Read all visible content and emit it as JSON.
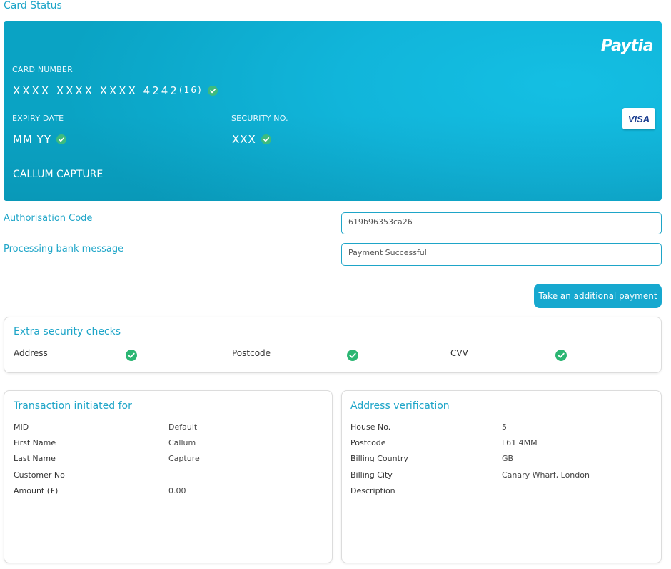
{
  "page_title": "Card Status",
  "card": {
    "brand": "Paytia",
    "network": "VISA",
    "number_label": "CARD NUMBER",
    "number_value": "XXXX XXXX XXXX 4242",
    "number_length": "(16)",
    "expiry_label": "EXPIRY DATE",
    "expiry_value": "MM YY",
    "security_label": "SECURITY NO.",
    "security_value": "XXX",
    "holder_name": "CALLUM CAPTURE"
  },
  "fields": {
    "auth_code_label": "Authorisation Code",
    "auth_code_value": "619b96353ca26",
    "bank_message_label": "Processing bank message",
    "bank_message_value": "Payment Successful"
  },
  "actions": {
    "additional_payment_label": "Take an additional payment"
  },
  "security_checks": {
    "title": "Extra security checks",
    "items": [
      {
        "label": "Address",
        "status": "passed"
      },
      {
        "label": "Postcode",
        "status": "passed"
      },
      {
        "label": "CVV",
        "status": "passed"
      }
    ]
  },
  "transaction": {
    "title": "Transaction initiated for",
    "rows": [
      {
        "label": "MID",
        "value": "Default"
      },
      {
        "label": "First Name",
        "value": "Callum"
      },
      {
        "label": "Last Name",
        "value": "Capture"
      },
      {
        "label": "Customer No",
        "value": ""
      },
      {
        "label": "Amount (£)",
        "value": "0.00"
      }
    ]
  },
  "address": {
    "title": "Address verification",
    "rows": [
      {
        "label": "House No.",
        "value": "5"
      },
      {
        "label": "Postcode",
        "value": "L61 4MM"
      },
      {
        "label": "Billing Country",
        "value": "GB"
      },
      {
        "label": "Billing City",
        "value": "Canary Wharf, London"
      },
      {
        "label": "Description",
        "value": ""
      }
    ]
  },
  "colors": {
    "accent": "#1ea5c8",
    "card": "#11b5da",
    "check_green": "#2bb673"
  }
}
